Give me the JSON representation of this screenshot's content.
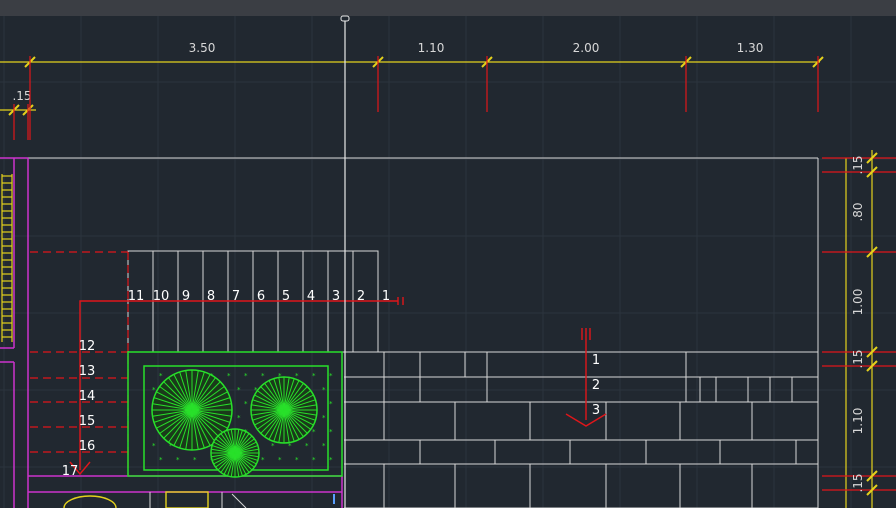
{
  "colors": {
    "background": "#212830",
    "grid": "#2e3640",
    "dimension": "#e4d11c",
    "extension": "#e0161a",
    "wall": "#d7d7d7",
    "magenta": "#cc33cc",
    "green": "#28e02a",
    "text": "#ffffff"
  },
  "top_dimensions": [
    "3.50",
    "1.10",
    "2.00",
    "1.30"
  ],
  "small_dimension": ".15",
  "right_dimensions": [
    ".15",
    ".80",
    "1.00",
    ".15",
    "1.10",
    ".15"
  ],
  "stair_a_steps": [
    "11",
    "10",
    "9",
    "8",
    "7",
    "6",
    "5",
    "4",
    "3",
    "2",
    "1"
  ],
  "stair_b_steps": [
    "12",
    "13",
    "14",
    "15",
    "16",
    "17"
  ],
  "stair_c_steps": [
    "1",
    "2",
    "3"
  ],
  "icons": [
    "tree-symbol",
    "stair-arrow-icon",
    "viewport-crosshair"
  ]
}
